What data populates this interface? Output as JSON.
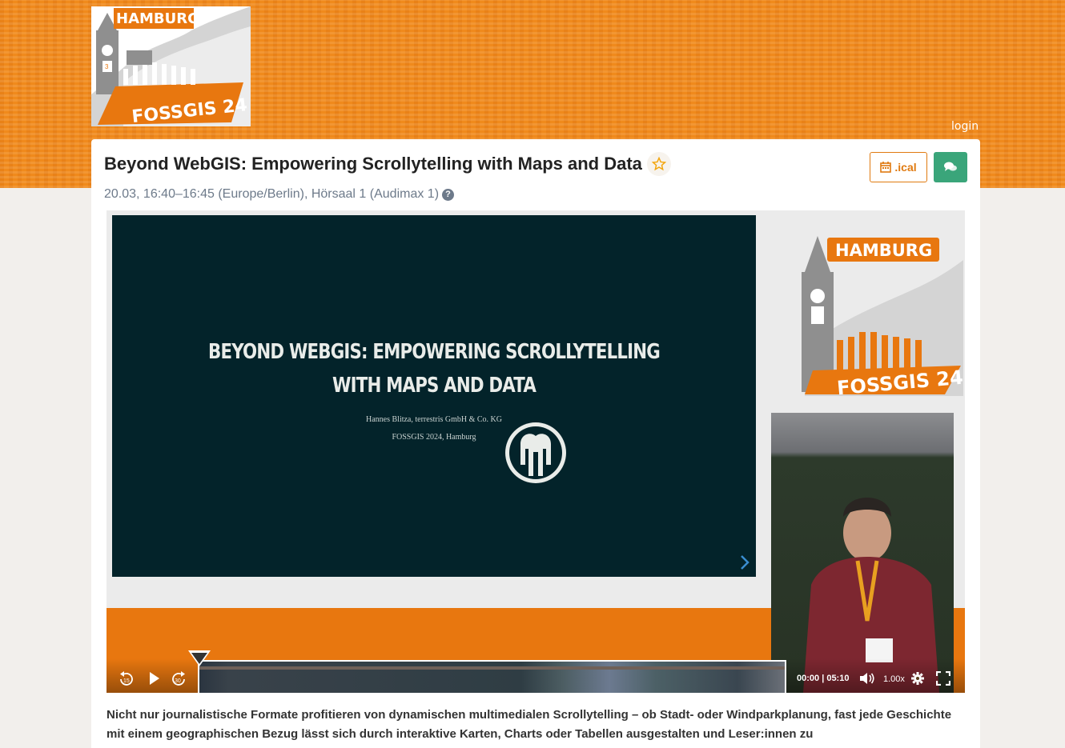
{
  "header": {
    "logo": {
      "city": "HAMBURG",
      "event": "FOSSGIS 24"
    },
    "login_label": "login",
    "colors": {
      "brand_orange": "#f08a1c",
      "logo_gray": "#8f8f8f"
    }
  },
  "talk": {
    "title": "Beyond WebGIS: Empowering Scrollytelling with Maps and Data",
    "favorite_icon": "star-icon",
    "meta": "20.03, 16:40–16:45 (Europe/Berlin), Hörsaal 1 (Audimax 1)",
    "help_icon": "question-circle-icon",
    "ical_label": ".ical",
    "ical_icon": "calendar-icon",
    "chat_icon": "comments-icon",
    "colors": {
      "ical_border": "#e07a10",
      "chat_bg": "#3aa57a",
      "meta_text": "#6d7a8a"
    }
  },
  "player": {
    "slide": {
      "title_line1": "BEYOND WEBGIS: EMPOWERING SCROLLYTELLING",
      "title_line2": "WITH MAPS AND DATA",
      "author": "Hannes Blitza, terrestris GmbH & Co. KG",
      "event": "FOSSGIS 2024, Hamburg",
      "next_icon": "chevron-right-icon",
      "background": "#03232a"
    },
    "side_logo": {
      "city": "HAMBURG",
      "event": "FOSSGIS 24"
    },
    "controls": {
      "rewind_label": "15",
      "forward_label": "30",
      "rewind_icon": "rewind-15-icon",
      "play_icon": "play-icon",
      "forward_icon": "forward-30-icon",
      "current_time": "00:00",
      "duration": "05:10",
      "time_readout": "00:00 | 05:10",
      "volume_icon": "volume-icon",
      "playback_rate": "1.00x",
      "settings_icon": "gear-icon",
      "fullscreen_icon": "fullscreen-icon",
      "progress": 0
    }
  },
  "description": "Nicht nur journalistische Formate profitieren von dynamischen multimedialen Scrollytelling – ob Stadt- oder Windparkplanung, fast jede Geschichte mit einem geographischen Bezug lässt sich durch interaktive Karten, Charts oder Tabellen ausgestalten und Leser:innen zu"
}
